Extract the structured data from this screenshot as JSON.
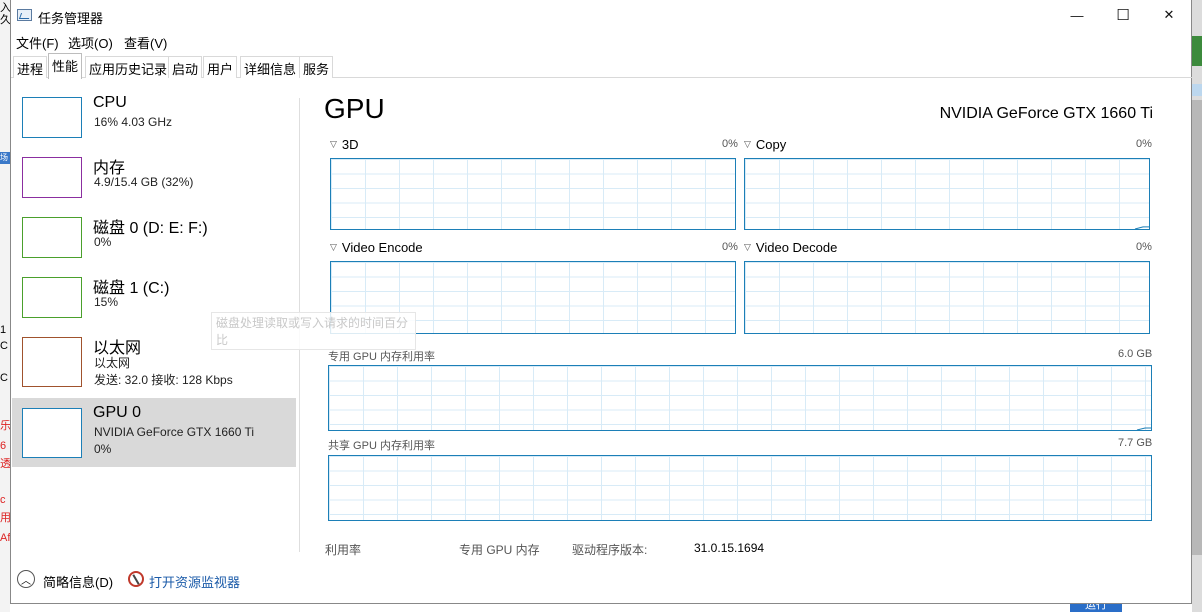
{
  "window": {
    "title": "任务管理器",
    "minimize": "—",
    "maximize": "☐",
    "close": "✕"
  },
  "menu": [
    {
      "label": "文件(F)"
    },
    {
      "label": "选项(O)"
    },
    {
      "label": "查看(V)"
    }
  ],
  "tabs": [
    {
      "label": "进程"
    },
    {
      "label": "性能"
    },
    {
      "label": "应用历史记录"
    },
    {
      "label": "启动"
    },
    {
      "label": "用户"
    },
    {
      "label": "详细信息"
    },
    {
      "label": "服务"
    }
  ],
  "sidebar": {
    "items": [
      {
        "title": "CPU",
        "sub1": "16% 4.03 GHz",
        "sub2": "",
        "color": "#1c7fb7"
      },
      {
        "title": "内存",
        "sub1": "4.9/15.4 GB (32%)",
        "sub2": "",
        "color": "#8b2ea0"
      },
      {
        "title": "磁盘 0 (D: E: F:)",
        "sub1": "0%",
        "sub2": "",
        "color": "#4aa02c"
      },
      {
        "title": "磁盘 1 (C:)",
        "sub1": "15%",
        "sub2": "",
        "color": "#4aa02c"
      },
      {
        "title": "以太网",
        "sub1": "以太网",
        "sub2": "发送: 32.0  接收: 128 Kbps",
        "color": "#a0522d"
      },
      {
        "title": "GPU 0",
        "sub1": "NVIDIA GeForce GTX 1660 Ti",
        "sub2": "0%",
        "color": "#1c7fb7"
      }
    ]
  },
  "main": {
    "title": "GPU",
    "device_name": "NVIDIA GeForce GTX 1660 Ti",
    "engines": [
      {
        "name": "3D",
        "pct": "0%",
        "level": 0
      },
      {
        "name": "Copy",
        "pct": "0%",
        "level": 0.03
      },
      {
        "name": "Video Encode",
        "pct": "0%",
        "level": 0
      },
      {
        "name": "Video Decode",
        "pct": "0%",
        "level": 0
      }
    ],
    "dedicated": {
      "label": "专用 GPU 内存利用率",
      "max": "6.0 GB",
      "level": 0.03
    },
    "shared": {
      "label": "共享 GPU 内存利用率",
      "max": "7.7 GB",
      "level": 0
    },
    "stats": {
      "util_label": "利用率",
      "dedicated_label": "专用 GPU 内存",
      "driver_label": "驱动程序版本:",
      "driver_value": "31.0.15.1694"
    }
  },
  "tooltip": "磁盘处理读取或写入请求的时间百分比",
  "footer": {
    "less": "简略信息(D)",
    "resource_monitor": "打开资源监视器"
  },
  "background": {
    "left_fragments": [
      "入",
      "久",
      "场",
      "1",
      "C",
      "C",
      "乐",
      "6",
      "透",
      "c",
      "用",
      "Af"
    ],
    "bottom_button": "运行"
  },
  "colors": {
    "graph_border": "#1c7fb7",
    "grid": "#d8ebf7",
    "link": "#1a5aa8"
  }
}
